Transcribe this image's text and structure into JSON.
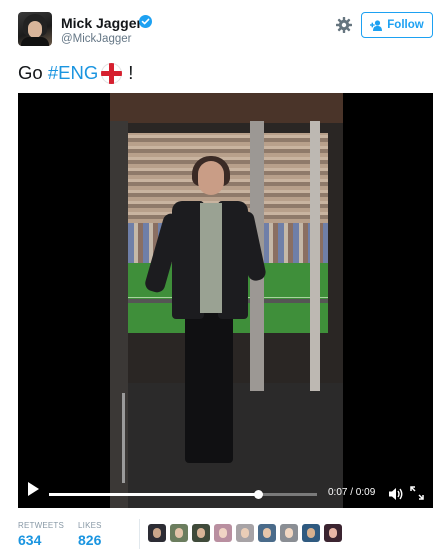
{
  "tweet": {
    "author_name": "Mick Jagger",
    "author_handle": "@MickJagger",
    "follow_label": "Follow",
    "text_prefix": "Go ",
    "hashtag": "#ENG",
    "text_suffix": "!"
  },
  "video": {
    "time": "0:07 / 0:09",
    "progress": 0.78
  },
  "stats": {
    "retweets_label": "RETWEETS",
    "retweets_value": "634",
    "likes_label": "LIKES",
    "likes_value": "826"
  },
  "likers_count": 9,
  "colors": {
    "accent": "#1da1f2",
    "link": "#1b95e0",
    "verified": "#1da1f2"
  },
  "icons": {
    "verified": "verified-badge-icon",
    "settings": "gear-icon",
    "follow": "add-user-icon",
    "flag": "england-flag-emoji",
    "play": "play-icon",
    "volume": "volume-icon",
    "fullscreen": "fullscreen-icon"
  }
}
